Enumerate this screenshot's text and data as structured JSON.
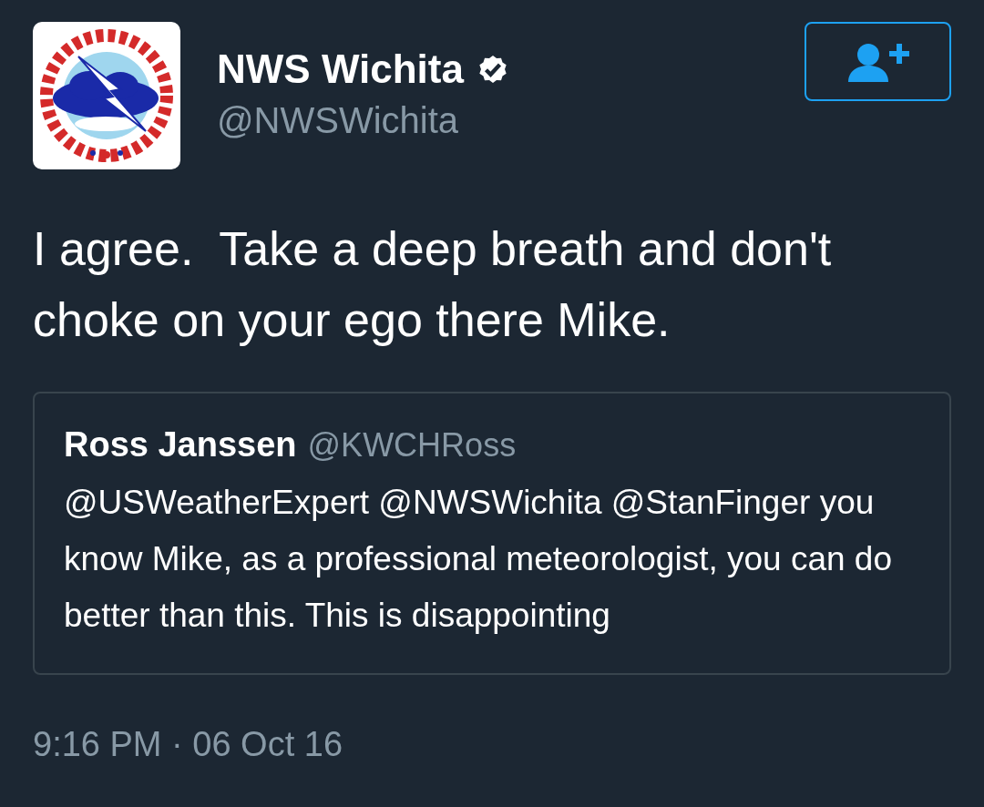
{
  "author": {
    "name": "NWS Wichita",
    "handle": "@NWSWichita",
    "verified": true
  },
  "follow_button": {
    "following": false
  },
  "text": "I agree.  Take a deep breath and don't choke on your ego there Mike.",
  "quoted_tweet": {
    "name": "Ross Janssen",
    "handle": "@KWCHRoss",
    "text": "@USWeatherExpert @NWSWichita @StanFinger you know Mike, as a professional meteorologist, you can do better than this. This is disappointing"
  },
  "timestamp": "9:16 PM · 06 Oct 16"
}
